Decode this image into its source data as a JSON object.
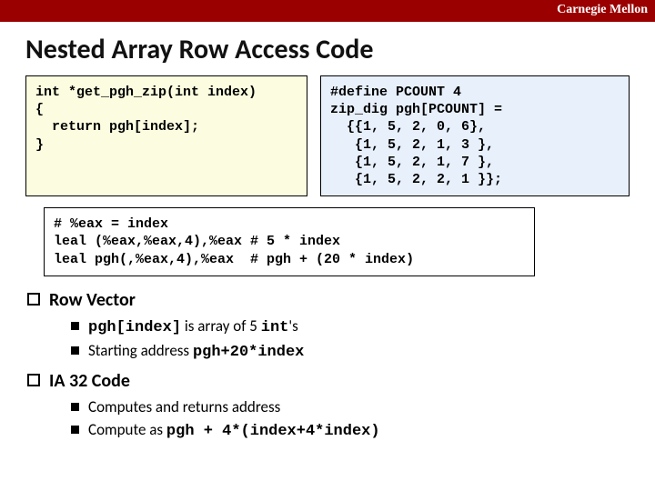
{
  "brand": "Carnegie Mellon",
  "title": "Nested Array Row Access Code",
  "code_c": "int *get_pgh_zip(int index)\n{\n  return pgh[index];\n}",
  "code_def": "#define PCOUNT 4\nzip_dig pgh[PCOUNT] =\n  {{1, 5, 2, 0, 6},\n   {1, 5, 2, 1, 3 },\n   {1, 5, 2, 1, 7 },\n   {1, 5, 2, 2, 1 }};",
  "code_asm": "# %eax = index\nleal (%eax,%eax,4),%eax # 5 * index\nleal pgh(,%eax,4),%eax  # pgh + (20 * index)",
  "sec1_title": "Row Vector",
  "sec1_b1a": "pgh[index]",
  "sec1_b1b": " is array of 5 ",
  "sec1_b1c": "int",
  "sec1_b1d": "'s",
  "sec1_b2a": "Starting address ",
  "sec1_b2b": "pgh+20*index",
  "sec2_title": "IA 32 Code",
  "sec2_b1": "Computes and returns address",
  "sec2_b2a": "Compute as ",
  "sec2_b2b": "pgh + 4*(index+4*index)"
}
